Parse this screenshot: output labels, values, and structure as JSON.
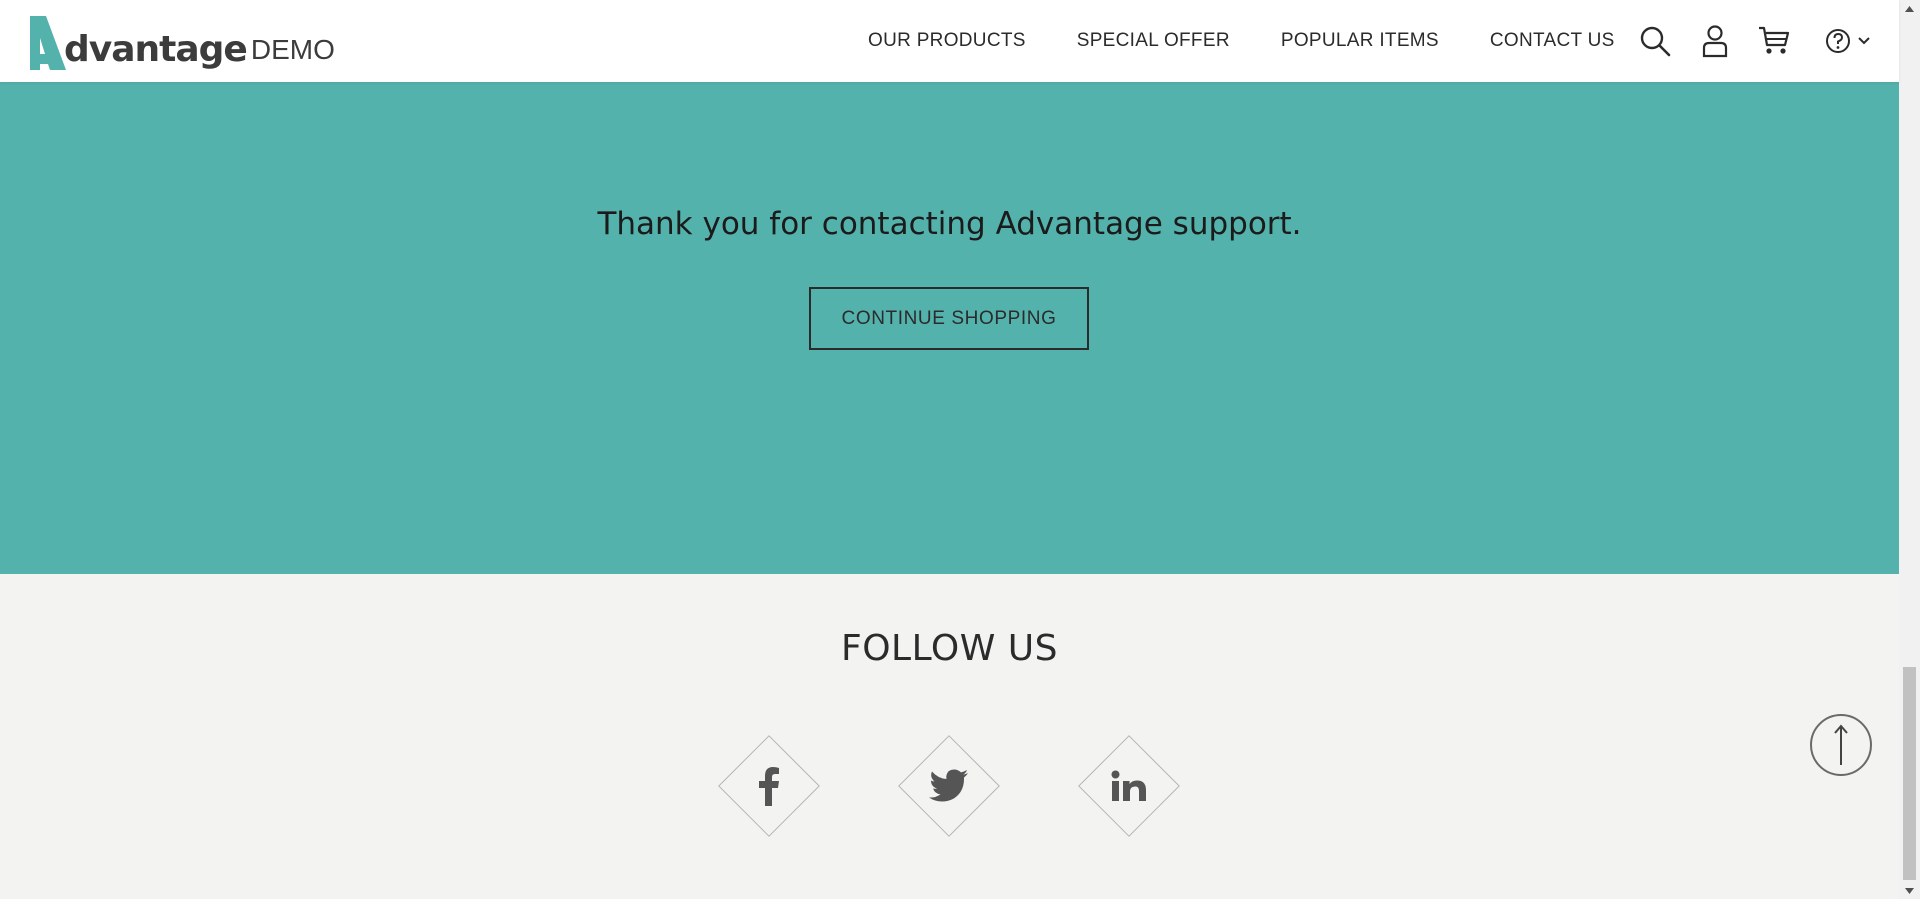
{
  "logo": {
    "brand": "dvantage",
    "suffix": "DEMO",
    "accent": "#54b2ad"
  },
  "nav": {
    "items": [
      {
        "label": "OUR PRODUCTS"
      },
      {
        "label": "SPECIAL OFFER"
      },
      {
        "label": "POPULAR ITEMS"
      },
      {
        "label": "CONTACT US"
      }
    ]
  },
  "header_icons": [
    "search-icon",
    "user-icon",
    "cart-icon",
    "help-icon",
    "chevron-down-icon"
  ],
  "confirmation": {
    "message": "Thank you for contacting Advantage support.",
    "continue_label": "CONTINUE SHOPPING",
    "background": "#54b2ad"
  },
  "footer": {
    "follow_title": "FOLLOW US",
    "social": [
      "facebook-icon",
      "twitter-icon",
      "linkedin-icon"
    ],
    "background": "#f3f3f1"
  }
}
